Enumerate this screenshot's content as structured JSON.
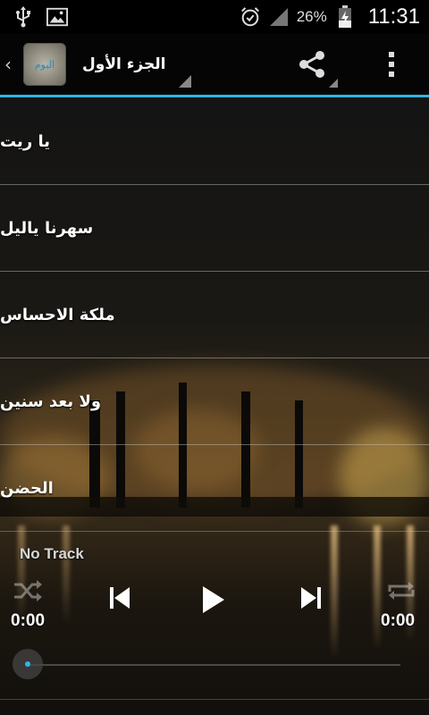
{
  "status_bar": {
    "icons": [
      "usb-icon",
      "image-icon",
      "alarm-icon",
      "signal-icon",
      "battery-charging-icon"
    ],
    "battery_percent": "26%",
    "time": "11:31"
  },
  "action_bar": {
    "title": "الجزء الأول",
    "app_icon_text": "اليوم",
    "accent_color": "#33b5e5",
    "icons": [
      "back-chevron-icon",
      "app-icon",
      "share-icon",
      "overflow-menu-icon"
    ]
  },
  "songs": [
    {
      "title": "يا ريت"
    },
    {
      "title": "سهرنا ياليل"
    },
    {
      "title": "ملكة الاحساس"
    },
    {
      "title": "ولا بعد سنين"
    },
    {
      "title": "الحضن"
    }
  ],
  "player": {
    "track_name": "No Track",
    "current_time": "0:00",
    "duration": "0:00",
    "progress": 0,
    "icons": [
      "shuffle-icon",
      "previous-icon",
      "play-icon",
      "next-icon",
      "repeat-icon"
    ]
  }
}
